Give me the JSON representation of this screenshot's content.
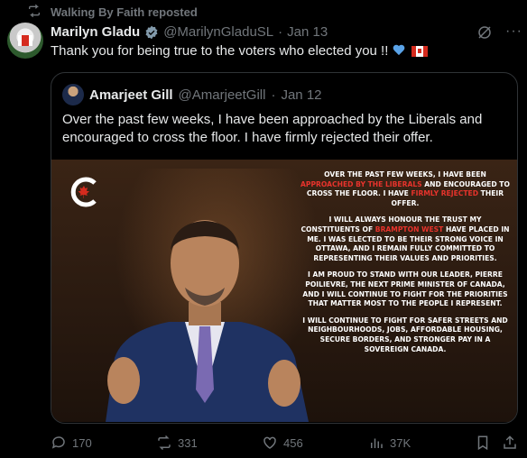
{
  "repost": {
    "label": "Walking By Faith reposted"
  },
  "post": {
    "author_name": "Marilyn Gladu",
    "handle": "@MarilynGladuSL",
    "separator": "·",
    "date": "Jan 13",
    "text": "Thank you for being true to the voters who elected you !!"
  },
  "quote": {
    "author_name": "Amarjeet Gill",
    "handle": "@AmarjeetGill",
    "separator": "·",
    "date": "Jan 12",
    "text": "Over the past few weeks, I have been approached by the Liberals and encouraged to cross the floor. I have firmly rejected their offer.",
    "image": {
      "p1_a": "OVER THE PAST FEW WEEKS, I HAVE BEEN",
      "p1_b": "APPROACHED BY THE LIBERALS",
      "p1_c": "AND ENCOURAGED TO CROSS THE FLOOR. I HAVE",
      "p1_d": "FIRMLY REJECTED",
      "p1_e": "THEIR OFFER.",
      "p2_a": "I WILL ALWAYS HONOUR THE TRUST MY CONSTITUENTS OF",
      "p2_b": "BRAMPTON WEST",
      "p2_c": "HAVE PLACED IN ME. I WAS ELECTED TO BE THEIR STRONG VOICE IN OTTAWA, AND I REMAIN FULLY COMMITTED TO REPRESENTING THEIR VALUES AND PRIORITIES.",
      "p3": "I AM PROUD TO STAND WITH OUR LEADER, PIERRE POILIEVRE, THE NEXT PRIME MINISTER OF CANADA, AND I WILL CONTINUE TO FIGHT FOR THE PRIORITIES THAT MATTER MOST TO THE PEOPLE I REPRESENT.",
      "p4": "I WILL CONTINUE TO FIGHT FOR SAFER STREETS AND NEIGHBOURHOODS, JOBS, AFFORDABLE HOUSING, SECURE BORDERS, AND STRONGER PAY IN A SOVEREIGN CANADA."
    }
  },
  "actions": {
    "replies": "170",
    "reposts": "331",
    "likes": "456",
    "views": "37K"
  },
  "colors": {
    "background": "#000000",
    "text": "#e7e9ea",
    "muted": "#71767b",
    "verified": "#829aab",
    "accent_red": "#e8332c"
  }
}
